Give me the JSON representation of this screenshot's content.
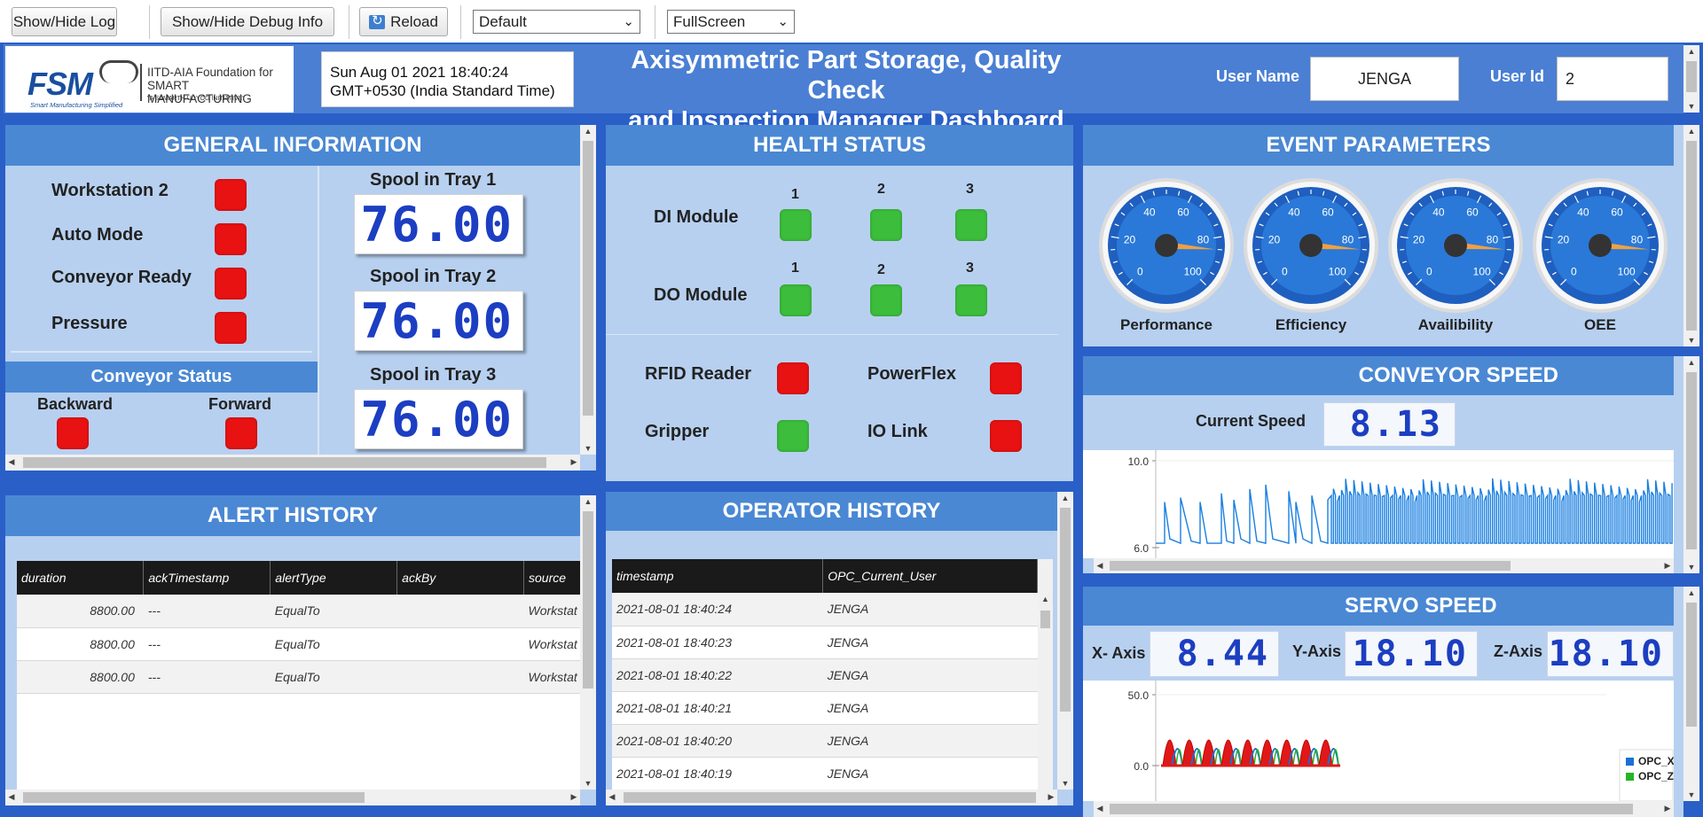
{
  "toolbar": {
    "show_hide_log": "Show/Hide Log",
    "show_hide_debug": "Show/Hide Debug Info",
    "reload": "Reload",
    "layout_select": "Default",
    "view_select": "FullScreen"
  },
  "header": {
    "logo_fsm": "FSM",
    "logo_line1": "IITD-AIA Foundation for",
    "logo_line2": "SMART MANUFACTURING",
    "logo_tagline": "\"A SAMARTH UDYOG INITIATIVE\"",
    "logo_sub": "Smart Manufacturing Simplified",
    "datetime_line1": "Sun Aug 01 2021 18:40:24",
    "datetime_line2": "GMT+0530 (India Standard Time)",
    "title_line1": "Axisymmetric Part Storage, Quality Check",
    "title_line2": "and Inspection Manager Dashboard",
    "user_name_label": "User Name",
    "user_name_value": "JENGA",
    "user_id_label": "User Id",
    "user_id_value": "2"
  },
  "general": {
    "title": "GENERAL INFORMATION",
    "items": [
      {
        "label": "Workstation 2",
        "status": "red"
      },
      {
        "label": "Auto Mode",
        "status": "red"
      },
      {
        "label": "Conveyor Ready",
        "status": "red"
      },
      {
        "label": "Pressure",
        "status": "red"
      }
    ],
    "conveyor_status_title": "Conveyor Status",
    "backward_label": "Backward",
    "forward_label": "Forward",
    "spools": [
      {
        "label": "Spool in Tray 1",
        "value": "76.00"
      },
      {
        "label": "Spool in Tray 2",
        "value": "76.00"
      },
      {
        "label": "Spool in Tray 3",
        "value": "76.00"
      }
    ]
  },
  "health": {
    "title": "HEALTH STATUS",
    "di_label": "DI Module",
    "do_label": "DO Module",
    "channels": [
      "1",
      "2",
      "3"
    ],
    "rfid_label": "RFID Reader",
    "powerflex_label": "PowerFlex",
    "gripper_label": "Gripper",
    "iolink_label": "IO Link"
  },
  "events": {
    "title": "EVENT PARAMETERS",
    "gauge_ticks": [
      "0",
      "20",
      "40",
      "60",
      "80",
      "100"
    ],
    "gauges": [
      {
        "label": "Performance",
        "value": 85
      },
      {
        "label": "Efficiency",
        "value": 85
      },
      {
        "label": "Availibility",
        "value": 85
      },
      {
        "label": "OEE",
        "value": 85
      }
    ]
  },
  "conveyor": {
    "title": "CONVEYOR SPEED",
    "current_label": "Current Speed",
    "current_value": "8.13",
    "y_ticks": [
      "10.0",
      "6.0"
    ]
  },
  "servo": {
    "title": "SERVO SPEED",
    "x_label": "X- Axis",
    "x_value": "8.44",
    "y_label": "Y-Axis",
    "y_value": "18.10",
    "z_label": "Z-Axis",
    "z_value": "18.10",
    "y_ticks": [
      "50.0",
      "0.0"
    ],
    "legend": [
      {
        "name": "OPC_X",
        "color": "#1a6fd6"
      },
      {
        "name": "OPC_Z",
        "color": "#28b428"
      }
    ]
  },
  "alerts": {
    "title": "ALERT HISTORY",
    "columns": [
      "duration",
      "ackTimestamp",
      "alertType",
      "ackBy",
      "source"
    ],
    "rows": [
      [
        "8800.00",
        "---",
        "EqualTo",
        "",
        "Workstat"
      ],
      [
        "8800.00",
        "---",
        "EqualTo",
        "",
        "Workstat"
      ],
      [
        "8800.00",
        "---",
        "EqualTo",
        "",
        "Workstat"
      ]
    ]
  },
  "operators": {
    "title": "OPERATOR HISTORY",
    "columns": [
      "timestamp",
      "OPC_Current_User"
    ],
    "rows": [
      [
        "2021-08-01 18:40:24",
        "JENGA"
      ],
      [
        "2021-08-01 18:40:23",
        "JENGA"
      ],
      [
        "2021-08-01 18:40:22",
        "JENGA"
      ],
      [
        "2021-08-01 18:40:21",
        "JENGA"
      ],
      [
        "2021-08-01 18:40:20",
        "JENGA"
      ],
      [
        "2021-08-01 18:40:19",
        "JENGA"
      ]
    ]
  },
  "colors": {
    "accent": "#4a88d4",
    "panel_bg": "#b7d0f0",
    "status_red": "#e81212",
    "status_green": "#3cbd3c"
  }
}
